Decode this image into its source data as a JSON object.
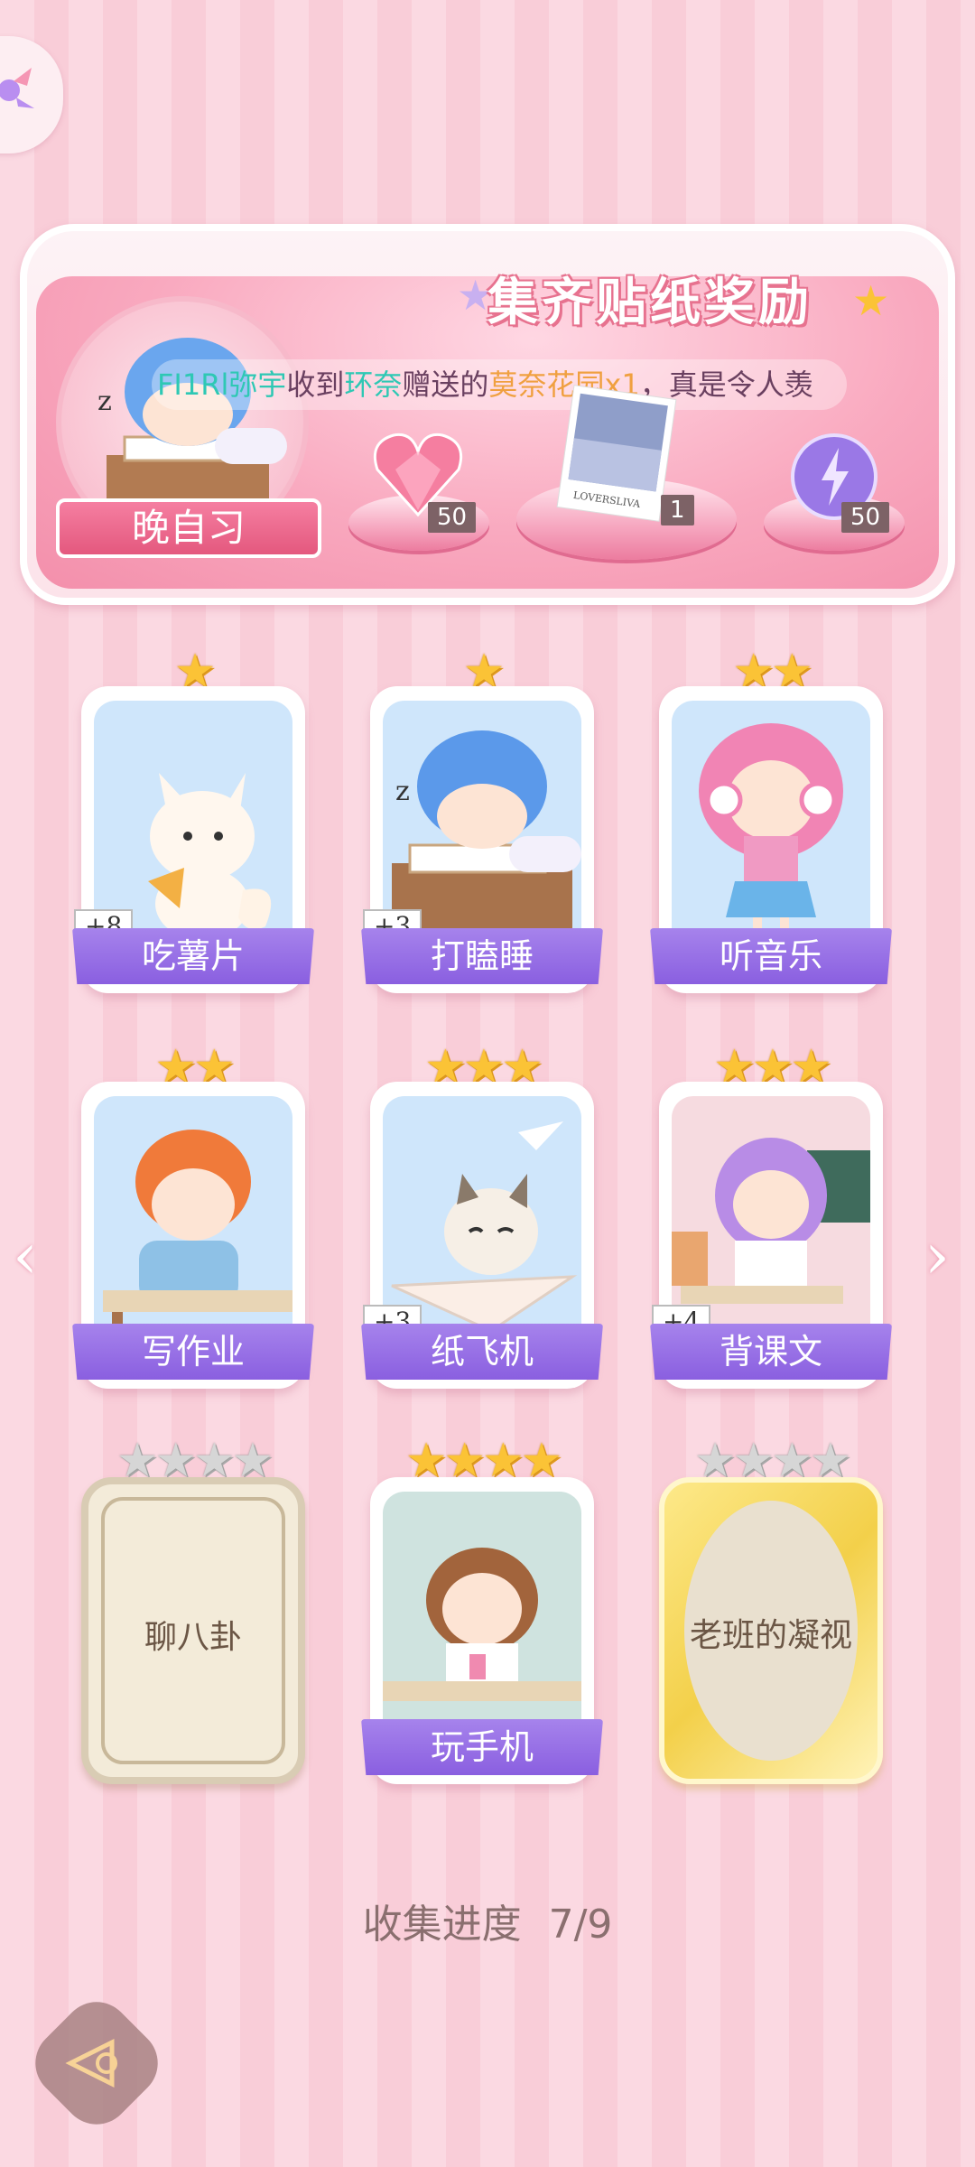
{
  "banner": {
    "title": "集齐贴纸奖励",
    "ticker": {
      "name1": "FI1Rl",
      "name2": "弥宇",
      "text1": "收到",
      "name3": "环奈",
      "text2": "赠送的",
      "item": "莫奈花园x1",
      "text3": "，真是令人羡"
    },
    "current_sticker": "晚自习",
    "rewards": [
      {
        "icon": "pink-heart-gem-icon",
        "count": "50"
      },
      {
        "icon": "monet-garden-photo-card-icon",
        "count": "1"
      },
      {
        "icon": "purple-lightning-orb-icon",
        "count": "50"
      }
    ]
  },
  "cards": [
    {
      "label": "吃薯片",
      "stars": "★",
      "bonus": "+8"
    },
    {
      "label": "打瞌睡",
      "stars": "★",
      "bonus": "+3"
    },
    {
      "label": "听音乐",
      "stars": "★★",
      "bonus": ""
    },
    {
      "label": "写作业",
      "stars": "★★",
      "bonus": ""
    },
    {
      "label": "纸飞机",
      "stars": "★★★",
      "bonus": "+3"
    },
    {
      "label": "背课文",
      "stars": "★★★",
      "bonus": "+4"
    },
    {
      "label": "聊八卦",
      "stars": "★★★★",
      "locked": true
    },
    {
      "label": "玩手机",
      "stars": "★★★★",
      "bonus": ""
    },
    {
      "label": "老班的凝视",
      "stars": "★★★★",
      "locked": true
    }
  ],
  "progress": {
    "label": "收集进度",
    "value": "7/9"
  },
  "nav": {
    "prev": "‹",
    "next": "›"
  },
  "colors": {
    "label_purple": "#8a5fe0",
    "star_gold": "#fbc336",
    "star_grey": "#d6d6d6"
  }
}
